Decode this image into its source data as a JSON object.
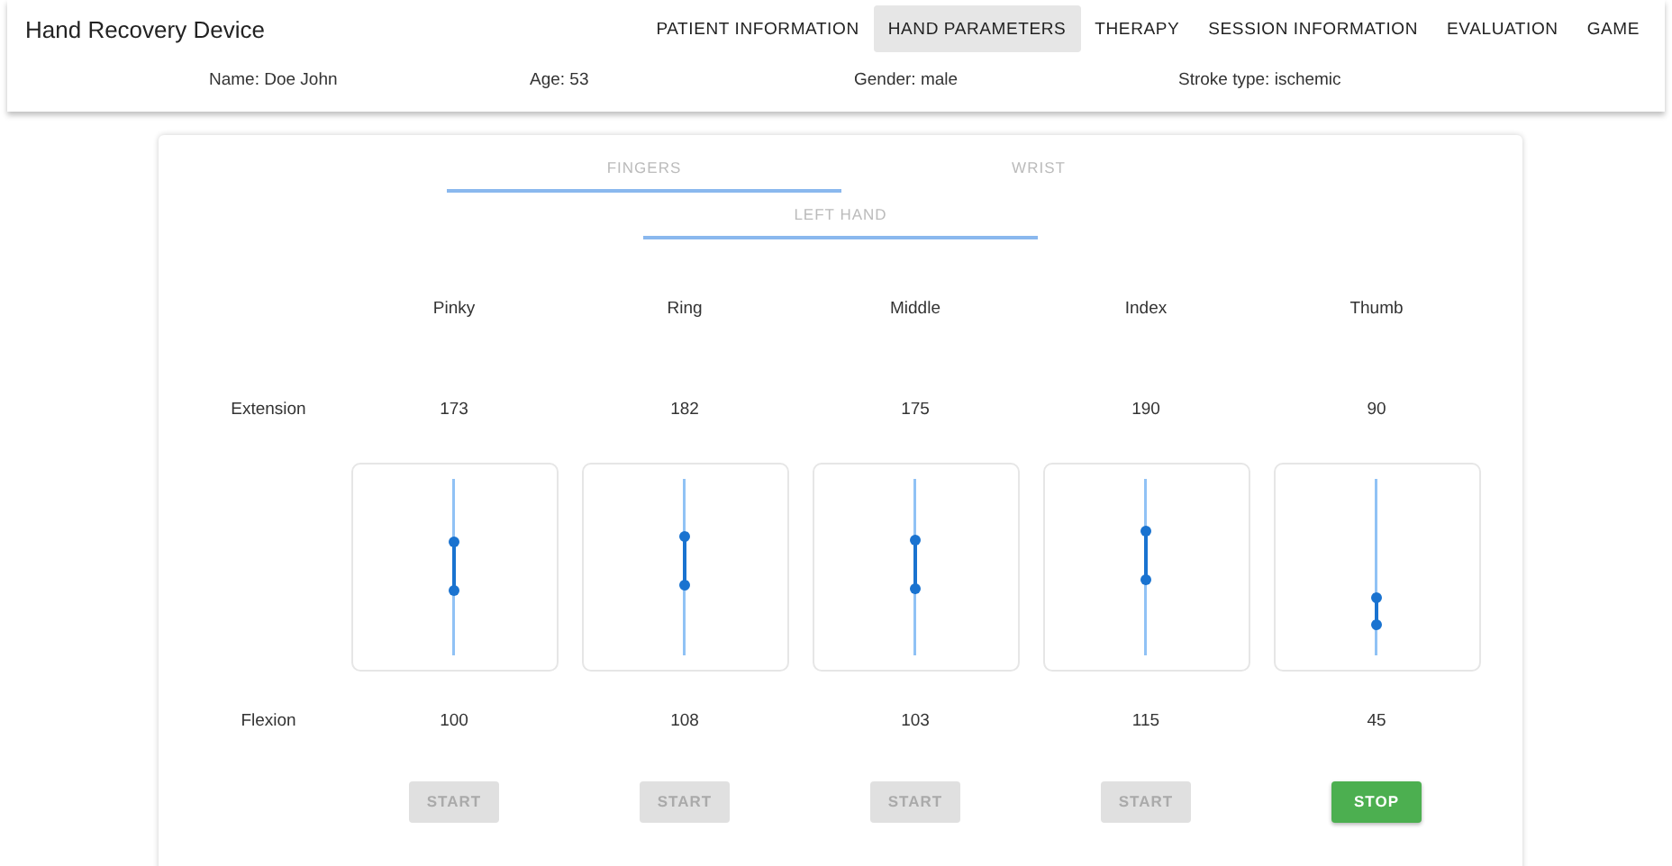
{
  "app_title": "Hand Recovery Device",
  "nav_tabs": [
    {
      "label": "PATIENT INFORMATION",
      "selected": false
    },
    {
      "label": "HAND PARAMETERS",
      "selected": true
    },
    {
      "label": "THERAPY",
      "selected": false
    },
    {
      "label": "SESSION INFORMATION",
      "selected": false
    },
    {
      "label": "EVALUATION",
      "selected": false
    },
    {
      "label": "GAME",
      "selected": false
    }
  ],
  "patient": [
    "Name: Doe John",
    "Age: 53",
    "Gender: male",
    "Stroke type: ischemic"
  ],
  "sub_tabs": [
    {
      "label": "FINGERS",
      "selected": true
    },
    {
      "label": "WRIST",
      "selected": false
    }
  ],
  "hand_tabs": [
    {
      "label": "LEFT HAND",
      "selected": true
    }
  ],
  "row_labels": {
    "extension": "Extension",
    "flexion": "Flexion"
  },
  "fingers": [
    {
      "name": "Pinky",
      "extension": "173",
      "flexion": "100",
      "range": {
        "high": {
          "level": 0.64
        },
        "low": {
          "level": 0.37
        }
      },
      "button": {
        "kind": "start",
        "label": "START",
        "disabled": true
      }
    },
    {
      "name": "Ring",
      "extension": "182",
      "flexion": "108",
      "range": {
        "high": {
          "level": 0.67
        },
        "low": {
          "level": 0.4
        }
      },
      "button": {
        "kind": "start",
        "label": "START",
        "disabled": true
      }
    },
    {
      "name": "Middle",
      "extension": "175",
      "flexion": "103",
      "range": {
        "high": {
          "level": 0.65
        },
        "low": {
          "level": 0.38
        }
      },
      "button": {
        "kind": "start",
        "label": "START",
        "disabled": true
      }
    },
    {
      "name": "Index",
      "extension": "190",
      "flexion": "115",
      "range": {
        "high": {
          "level": 0.7
        },
        "low": {
          "level": 0.43
        }
      },
      "button": {
        "kind": "start",
        "label": "START",
        "disabled": true
      }
    },
    {
      "name": "Thumb",
      "extension": "90",
      "flexion": "45",
      "range": {
        "high": {
          "level": 0.33
        },
        "low": {
          "level": 0.17
        }
      },
      "button": {
        "kind": "stop",
        "label": "STOP",
        "disabled": false
      }
    }
  ]
}
